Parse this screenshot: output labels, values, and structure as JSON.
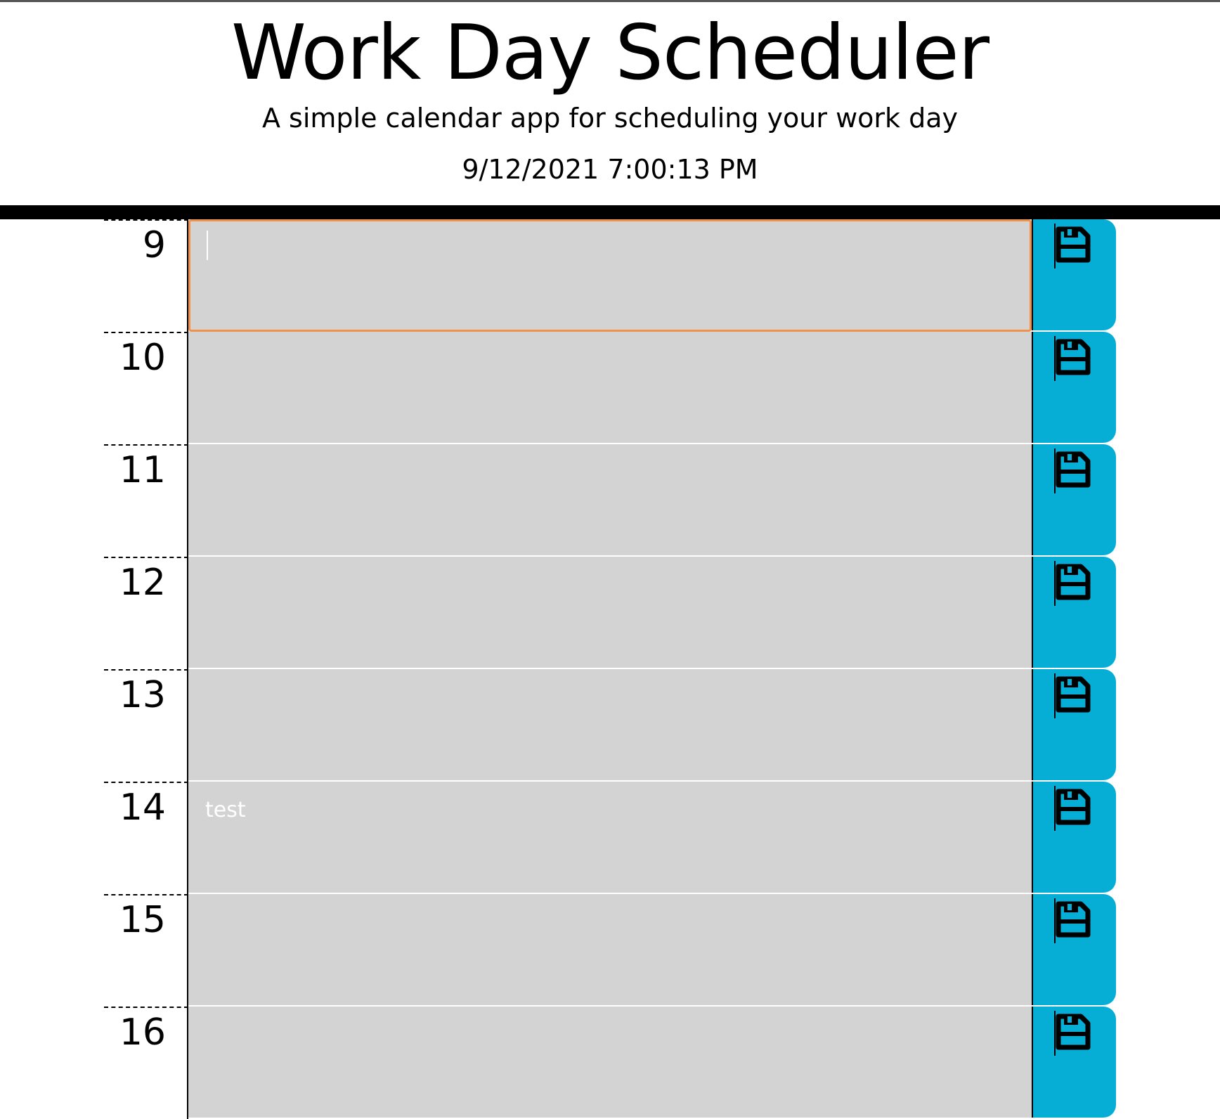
{
  "header": {
    "title": "Work Day Scheduler",
    "lead": "A simple calendar app for scheduling your work day",
    "current_day": "9/12/2021 7:00:13 PM"
  },
  "colors": {
    "past_block": "#d3d3d3",
    "save_button": "#06aed5",
    "focus_border": "#f0924e",
    "header_border": "#000000"
  },
  "icons": {
    "save": "floppy-disk-icon"
  },
  "schedule": [
    {
      "hour": "9",
      "text": "",
      "focused": true
    },
    {
      "hour": "10",
      "text": ""
    },
    {
      "hour": "11",
      "text": ""
    },
    {
      "hour": "12",
      "text": ""
    },
    {
      "hour": "13",
      "text": ""
    },
    {
      "hour": "14",
      "text": "test"
    },
    {
      "hour": "15",
      "text": ""
    },
    {
      "hour": "16",
      "text": ""
    }
  ]
}
